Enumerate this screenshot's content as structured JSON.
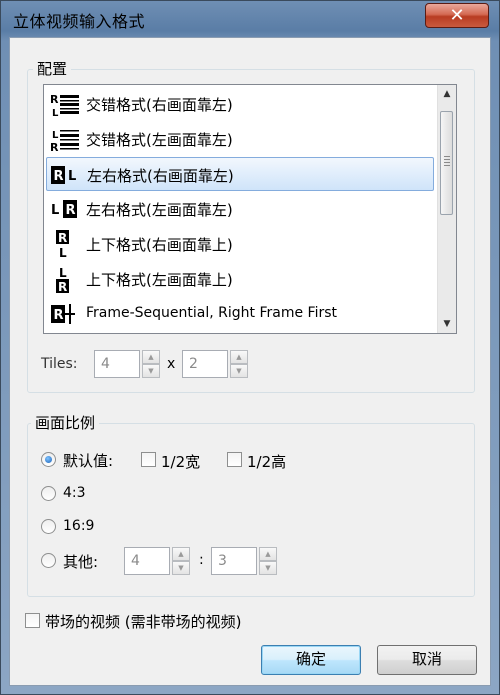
{
  "window": {
    "title": "立体视频输入格式",
    "close_label": "✕"
  },
  "config": {
    "group_label": "配置",
    "items": [
      {
        "icon": "interleaved-rl-icon",
        "label": "交错格式(右画面靠左)"
      },
      {
        "icon": "interleaved-lr-icon",
        "label": "交错格式(左画面靠左)"
      },
      {
        "icon": "side-by-side-rl-icon",
        "label": "左右格式(右画面靠左)",
        "selected": true
      },
      {
        "icon": "side-by-side-lr-icon",
        "label": "左右格式(左画面靠左)"
      },
      {
        "icon": "top-bottom-rl-icon",
        "label": "上下格式(右画面靠上)"
      },
      {
        "icon": "top-bottom-lr-icon",
        "label": "上下格式(左画面靠上)"
      },
      {
        "icon": "frame-sequential-icon",
        "label": "Frame-Sequential, Right Frame First"
      }
    ],
    "scroll_up": "▲",
    "scroll_down": "▼",
    "tiles_label": "Tiles:",
    "tiles_x": "4",
    "tiles_sep": "x",
    "tiles_y": "2"
  },
  "aspect": {
    "group_label": "画面比例",
    "default_label": "默认值:",
    "half_width": "1/2宽",
    "half_height": "1/2高",
    "ratio_43": "4:3",
    "ratio_169": "16:9",
    "other_label": "其他:",
    "other_w": "4",
    "other_sep": ":",
    "other_h": "3"
  },
  "field_video": {
    "label": "带场的视频 (需非带场的视频)"
  },
  "buttons": {
    "ok": "确定",
    "cancel": "取消"
  }
}
